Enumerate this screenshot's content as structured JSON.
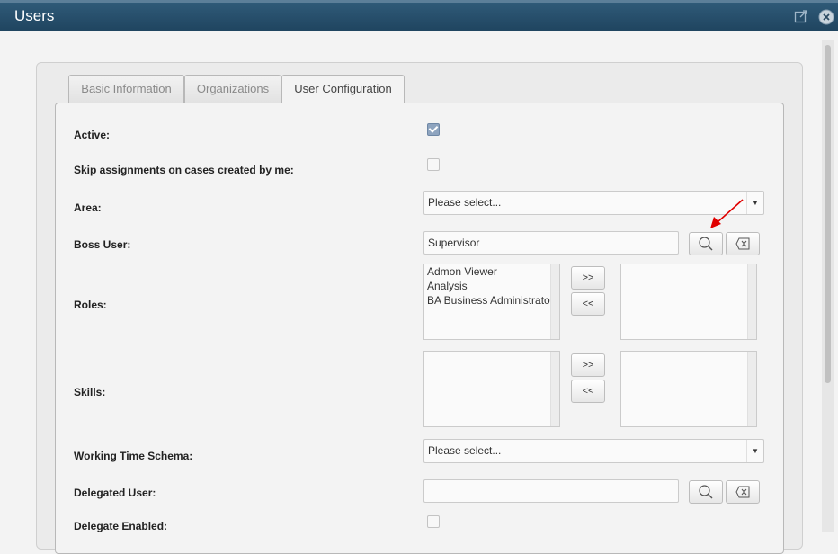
{
  "window": {
    "title": "Users",
    "icons": [
      "popout-icon",
      "close-icon"
    ]
  },
  "tabs": [
    {
      "label": "Basic Information",
      "active": false
    },
    {
      "label": "Organizations",
      "active": false
    },
    {
      "label": "User Configuration",
      "active": true
    }
  ],
  "form": {
    "active": {
      "label": "Active:",
      "checked": true
    },
    "skip_assignments": {
      "label": "Skip assignments on cases created by me:",
      "checked": false
    },
    "area": {
      "label": "Area:",
      "value": "Please select..."
    },
    "boss_user": {
      "label": "Boss User:",
      "value": "Supervisor"
    },
    "roles": {
      "label": "Roles:",
      "available": [
        "Admon Viewer",
        "Analysis",
        "BA Business Administrator"
      ],
      "selected": [],
      "add_label": ">>",
      "remove_label": "<<"
    },
    "skills": {
      "label": "Skills:",
      "available": [],
      "selected": [],
      "add_label": ">>",
      "remove_label": "<<"
    },
    "working_time_schema": {
      "label": "Working Time Schema:",
      "value": "Please select..."
    },
    "delegated_user": {
      "label": "Delegated User:",
      "value": ""
    },
    "delegate_enabled": {
      "label": "Delegate Enabled:",
      "checked": false
    }
  },
  "colors": {
    "titlebar": "#1f445f",
    "annotation_arrow": "#e00000"
  }
}
